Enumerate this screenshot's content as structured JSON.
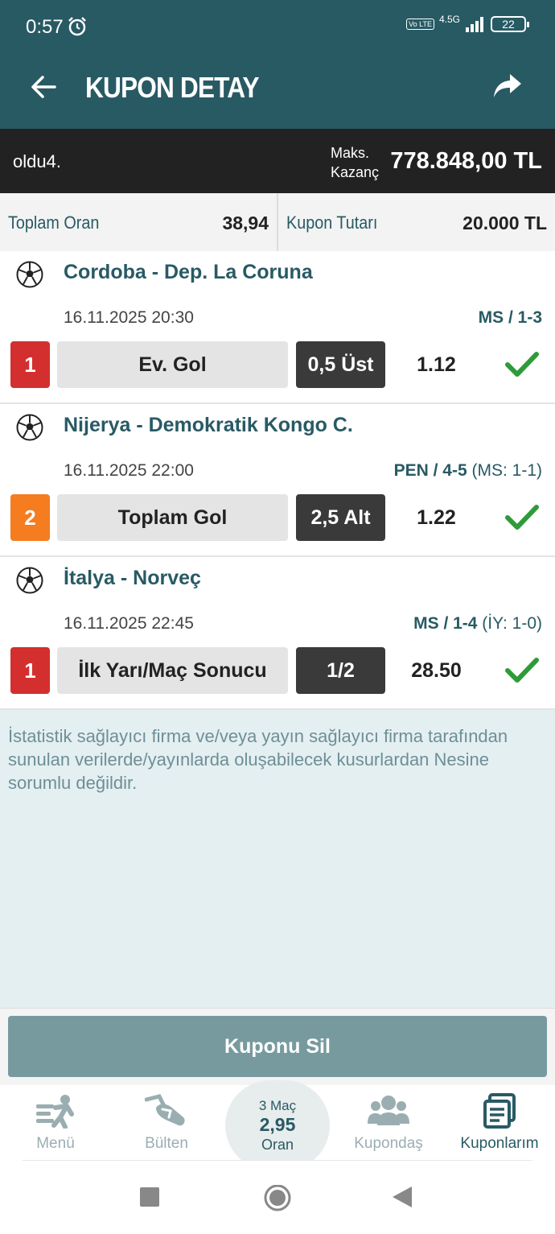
{
  "status_bar": {
    "time": "0:57",
    "volte": "Vo LTE",
    "network": "4.5G",
    "battery": "22"
  },
  "header": {
    "title": "KUPON DETAY"
  },
  "coupon": {
    "name": "oldu4.",
    "max_label_line1": "Maks.",
    "max_label_line2": "Kazanç",
    "max_value": "778.848,00 TL"
  },
  "summary": {
    "total_odds_label": "Toplam Oran",
    "total_odds_value": "38,94",
    "amount_label": "Kupon Tutarı",
    "amount_value": "20.000 TL"
  },
  "matches": [
    {
      "title": "Cordoba - Dep. La Coruna",
      "date": "16.11.2025 20:30",
      "result_bold": "MS / 1-3",
      "result_extra": "",
      "pick_number": "1",
      "badge_color": "#d32f2f",
      "bet_type": "Ev. Gol",
      "pick": "0,5 Üst",
      "odd": "1.12"
    },
    {
      "title": "Nijerya - Demokratik Kongo C.",
      "date": "16.11.2025 22:00",
      "result_bold": "PEN / 4-5",
      "result_extra": " (MS: 1-1)",
      "pick_number": "2",
      "badge_color": "#f57c1f",
      "bet_type": "Toplam Gol",
      "pick": "2,5 Alt",
      "odd": "1.22"
    },
    {
      "title": "İtalya - Norveç",
      "date": "16.11.2025 22:45",
      "result_bold": "MS / 1-4",
      "result_extra": " (İY: 1-0)",
      "pick_number": "1",
      "badge_color": "#d32f2f",
      "bet_type": "İlk Yarı/Maç Sonucu",
      "pick": "1/2",
      "odd": "28.50"
    }
  ],
  "disclaimer": "İstatistik sağlayıcı firma ve/veya yayın sağlayıcı firma tarafından sunulan verilerde/yayınlarda oluşabilecek kusurlardan Nesine sorumlu değildir.",
  "actions": {
    "delete_label": "Kuponu Sil"
  },
  "bottom_nav": {
    "menu": "Menü",
    "bulletin": "Bülten",
    "bubble_count": "3 Maç",
    "bubble_odds": "2,95",
    "bubble_label": "Oran",
    "kupondas": "Kupondaş",
    "kuponlarim": "Kuponlarım"
  },
  "colors": {
    "primary": "#285a64",
    "success": "#2e9b3a",
    "delete_button": "#779a9e"
  }
}
